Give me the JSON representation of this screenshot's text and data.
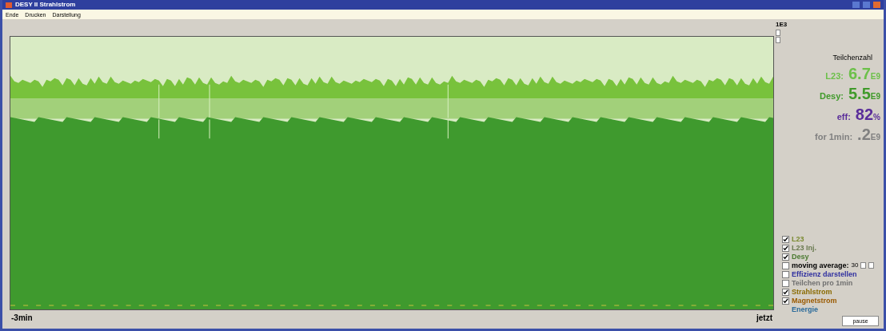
{
  "window": {
    "title": "DESY II Strahlstrom"
  },
  "menu": [
    "Ende",
    "Drucken",
    "Darstellung"
  ],
  "scale_label": "1E3",
  "panel": {
    "heading": "Teilchenzahl",
    "readings": [
      {
        "label": "L23:",
        "value": "6.7",
        "unit": "E9",
        "color": "#6cc04a"
      },
      {
        "label": "Desy:",
        "value": "5.5",
        "unit": "E9",
        "color": "#3f9a2a"
      },
      {
        "label": "eff:",
        "value": "82",
        "unit": "%",
        "color": "#5a2d9a"
      },
      {
        "label": "for 1min:",
        "value": ".2",
        "unit": "E9",
        "color": "#808080"
      }
    ]
  },
  "options": [
    {
      "kind": "check",
      "label": "L23",
      "checked": true,
      "color": "#7a8a30"
    },
    {
      "kind": "check",
      "label": "L23 Inj.",
      "checked": true,
      "color": "#6a7a50"
    },
    {
      "kind": "check",
      "label": "Desy",
      "checked": true,
      "color": "#4a7a30"
    },
    {
      "kind": "average",
      "label": "moving average:",
      "checked": false,
      "value": "30",
      "color": "#000000"
    },
    {
      "kind": "check",
      "label": "Effizienz darstellen",
      "checked": false,
      "color": "#3030a0"
    },
    {
      "kind": "check",
      "label": "Teilchen pro 1min",
      "checked": false,
      "color": "#707070"
    },
    {
      "kind": "check",
      "label": "Strahlstrom",
      "checked": true,
      "color": "#8a6a00"
    },
    {
      "kind": "check",
      "label": "Magnetstrom",
      "checked": true,
      "color": "#9a5a00"
    },
    {
      "kind": "text",
      "label": "Energie",
      "color": "#2a6a9a"
    }
  ],
  "axis": {
    "start": "-3min",
    "end": "jetzt"
  },
  "button": "pause"
}
